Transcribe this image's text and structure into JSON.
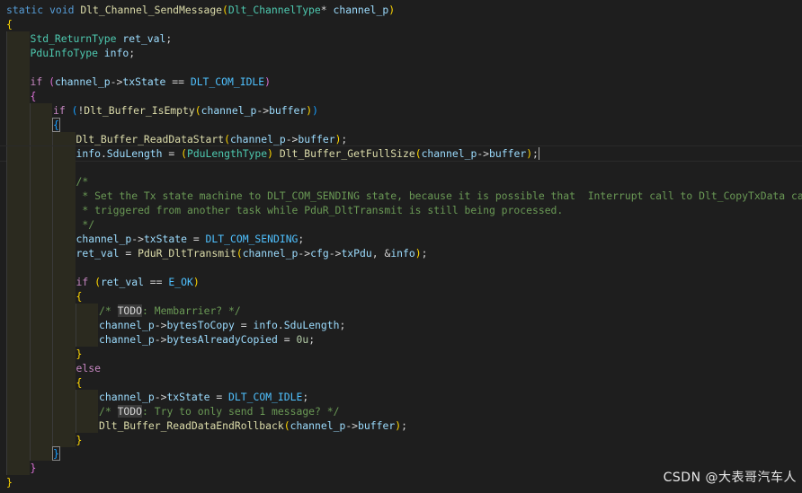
{
  "editor": {
    "lines": [
      {
        "tokens": [
          [
            "kw",
            "static"
          ],
          [
            "op",
            " "
          ],
          [
            "kw",
            "void"
          ],
          [
            "op",
            " "
          ],
          [
            "fn",
            "Dlt_Channel_SendMessage"
          ],
          [
            "br-gold",
            "("
          ],
          [
            "ty",
            "Dlt_ChannelType"
          ],
          [
            "op",
            "* "
          ],
          [
            "var",
            "channel_p"
          ],
          [
            "br-gold",
            ")"
          ]
        ]
      },
      {
        "tokens": [
          [
            "br-gold",
            "{"
          ]
        ]
      },
      {
        "tokens": [
          [
            "ty",
            "Std_ReturnType"
          ],
          [
            "op",
            " "
          ],
          [
            "var",
            "ret_val"
          ],
          [
            "op",
            ";"
          ]
        ]
      },
      {
        "tokens": [
          [
            "ty",
            "PduInfoType"
          ],
          [
            "op",
            " "
          ],
          [
            "var",
            "info"
          ],
          [
            "op",
            ";"
          ]
        ]
      },
      {
        "tokens": []
      },
      {
        "tokens": [
          [
            "ctrl",
            "if"
          ],
          [
            "op",
            " "
          ],
          [
            "br-pur",
            "("
          ],
          [
            "var",
            "channel_p"
          ],
          [
            "op",
            "->"
          ],
          [
            "var",
            "txState"
          ],
          [
            "op",
            " == "
          ],
          [
            "mac",
            "DLT_COM_IDLE"
          ],
          [
            "br-pur",
            ")"
          ]
        ]
      },
      {
        "tokens": [
          [
            "br-pur",
            "{"
          ]
        ]
      },
      {
        "tokens": [
          [
            "ctrl",
            "if"
          ],
          [
            "op",
            " "
          ],
          [
            "br-blu",
            "("
          ],
          [
            "op",
            "!"
          ],
          [
            "fn",
            "Dlt_Buffer_IsEmpty"
          ],
          [
            "br-gold",
            "("
          ],
          [
            "var",
            "channel_p"
          ],
          [
            "op",
            "->"
          ],
          [
            "var",
            "buffer"
          ],
          [
            "br-gold",
            ")"
          ],
          [
            "br-blu",
            ")"
          ]
        ]
      },
      {
        "tokens": [
          [
            "br-blu",
            "{"
          ]
        ]
      },
      {
        "tokens": [
          [
            "fn",
            "Dlt_Buffer_ReadDataStart"
          ],
          [
            "br-gold",
            "("
          ],
          [
            "var",
            "channel_p"
          ],
          [
            "op",
            "->"
          ],
          [
            "var",
            "buffer"
          ],
          [
            "br-gold",
            ")"
          ],
          [
            "op",
            ";"
          ]
        ]
      },
      {
        "tokens": [
          [
            "var",
            "info"
          ],
          [
            "op",
            "."
          ],
          [
            "var",
            "SduLength"
          ],
          [
            "op",
            " = "
          ],
          [
            "br-gold",
            "("
          ],
          [
            "ty",
            "PduLengthType"
          ],
          [
            "br-gold",
            ")"
          ],
          [
            "op",
            " "
          ],
          [
            "fn",
            "Dlt_Buffer_GetFullSize"
          ],
          [
            "br-gold",
            "("
          ],
          [
            "var",
            "channel_p"
          ],
          [
            "op",
            "->"
          ],
          [
            "var",
            "buffer"
          ],
          [
            "br-gold",
            ")"
          ],
          [
            "op",
            ";"
          ]
        ]
      },
      {
        "tokens": []
      },
      {
        "tokens": [
          [
            "cm",
            "/*"
          ]
        ]
      },
      {
        "tokens": [
          [
            "cm",
            " * Set the Tx state machine to DLT_COM_SENDING state, because it is possible that  Interrupt call to Dlt_CopyTxData can be"
          ]
        ]
      },
      {
        "tokens": [
          [
            "cm",
            " * triggered from another task while PduR_DltTransmit is still being processed."
          ]
        ]
      },
      {
        "tokens": [
          [
            "cm",
            " */"
          ]
        ]
      },
      {
        "tokens": [
          [
            "var",
            "channel_p"
          ],
          [
            "op",
            "->"
          ],
          [
            "var",
            "txState"
          ],
          [
            "op",
            " = "
          ],
          [
            "mac",
            "DLT_COM_SENDING"
          ],
          [
            "op",
            ";"
          ]
        ]
      },
      {
        "tokens": [
          [
            "var",
            "ret_val"
          ],
          [
            "op",
            " = "
          ],
          [
            "fn",
            "PduR_DltTransmit"
          ],
          [
            "br-gold",
            "("
          ],
          [
            "var",
            "channel_p"
          ],
          [
            "op",
            "->"
          ],
          [
            "var",
            "cfg"
          ],
          [
            "op",
            "->"
          ],
          [
            "var",
            "txPdu"
          ],
          [
            "op",
            ", &"
          ],
          [
            "var",
            "info"
          ],
          [
            "br-gold",
            ")"
          ],
          [
            "op",
            ";"
          ]
        ]
      },
      {
        "tokens": []
      },
      {
        "tokens": [
          [
            "ctrl",
            "if"
          ],
          [
            "op",
            " "
          ],
          [
            "br-gold",
            "("
          ],
          [
            "var",
            "ret_val"
          ],
          [
            "op",
            " == "
          ],
          [
            "mac",
            "E_OK"
          ],
          [
            "br-gold",
            ")"
          ]
        ]
      },
      {
        "tokens": [
          [
            "br-gold",
            "{"
          ]
        ]
      },
      {
        "tokens": [
          [
            "cm",
            "/* "
          ],
          [
            "todo",
            "TODO"
          ],
          [
            "cm",
            ": Membarrier? */"
          ]
        ]
      },
      {
        "tokens": [
          [
            "var",
            "channel_p"
          ],
          [
            "op",
            "->"
          ],
          [
            "var",
            "bytesToCopy"
          ],
          [
            "op",
            " = "
          ],
          [
            "var",
            "info"
          ],
          [
            "op",
            "."
          ],
          [
            "var",
            "SduLength"
          ],
          [
            "op",
            ";"
          ]
        ]
      },
      {
        "tokens": [
          [
            "var",
            "channel_p"
          ],
          [
            "op",
            "->"
          ],
          [
            "var",
            "bytesAlreadyCopied"
          ],
          [
            "op",
            " = "
          ],
          [
            "num",
            "0u"
          ],
          [
            "op",
            ";"
          ]
        ]
      },
      {
        "tokens": [
          [
            "br-gold",
            "}"
          ]
        ]
      },
      {
        "tokens": [
          [
            "ctrl",
            "else"
          ]
        ]
      },
      {
        "tokens": [
          [
            "br-gold",
            "{"
          ]
        ]
      },
      {
        "tokens": [
          [
            "var",
            "channel_p"
          ],
          [
            "op",
            "->"
          ],
          [
            "var",
            "txState"
          ],
          [
            "op",
            " = "
          ],
          [
            "mac",
            "DLT_COM_IDLE"
          ],
          [
            "op",
            ";"
          ]
        ]
      },
      {
        "tokens": [
          [
            "cm",
            "/* "
          ],
          [
            "todo",
            "TODO"
          ],
          [
            "cm",
            ": Try to only send 1 message? */"
          ]
        ]
      },
      {
        "tokens": [
          [
            "fn",
            "Dlt_Buffer_ReadDataEndRollback"
          ],
          [
            "br-gold",
            "("
          ],
          [
            "var",
            "channel_p"
          ],
          [
            "op",
            "->"
          ],
          [
            "var",
            "buffer"
          ],
          [
            "br-gold",
            ")"
          ],
          [
            "op",
            ";"
          ]
        ]
      },
      {
        "tokens": [
          [
            "br-gold",
            "}"
          ]
        ]
      },
      {
        "tokens": [
          [
            "br-blu",
            "}"
          ]
        ]
      },
      {
        "tokens": [
          [
            "br-pur",
            "}"
          ]
        ]
      },
      {
        "tokens": [
          [
            "br-gold",
            "}"
          ]
        ]
      }
    ]
  },
  "watermark": {
    "text": "CSDN @大表哥汽车人"
  }
}
